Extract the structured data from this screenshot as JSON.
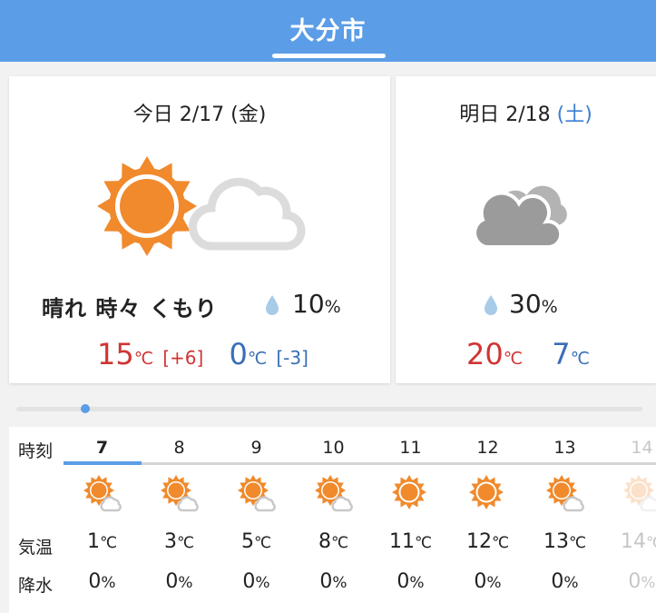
{
  "header": {
    "city": "大分市"
  },
  "today": {
    "date_label": "今日 2/17 (金)",
    "weather": "晴れ 時々 くもり",
    "precip": "10",
    "precip_unit": "%",
    "high": "15",
    "high_diff": "[+6]",
    "low": "0",
    "low_diff": "[-3]",
    "temp_unit": "℃",
    "icon": "sun-with-cloud-icon"
  },
  "tomorrow": {
    "date_prefix": "明日 2/18",
    "weekday": "(土)",
    "precip": "30",
    "precip_unit": "%",
    "high": "20",
    "low": "7",
    "temp_unit": "℃",
    "icon": "cloudy-icon"
  },
  "hourly": {
    "labels": {
      "time": "時刻",
      "temp": "気温",
      "precip": "降水"
    },
    "temp_unit": "℃",
    "precip_unit": "%",
    "hours": [
      {
        "hour": "7",
        "icon": "sun-cloud-icon",
        "temp": "1",
        "precip": "0"
      },
      {
        "hour": "8",
        "icon": "sun-cloud-icon",
        "temp": "3",
        "precip": "0"
      },
      {
        "hour": "9",
        "icon": "sun-cloud-icon",
        "temp": "5",
        "precip": "0"
      },
      {
        "hour": "10",
        "icon": "sun-cloud-icon",
        "temp": "8",
        "precip": "0"
      },
      {
        "hour": "11",
        "icon": "sun-icon",
        "temp": "11",
        "precip": "0"
      },
      {
        "hour": "12",
        "icon": "sun-icon",
        "temp": "12",
        "precip": "0"
      },
      {
        "hour": "13",
        "icon": "sun-cloud-icon",
        "temp": "13",
        "precip": "0"
      },
      {
        "hour": "14",
        "icon": "sun-cloud-icon",
        "temp": "14",
        "precip": "0"
      }
    ]
  },
  "colors": {
    "accent": "#5b9de6",
    "high": "#d03434",
    "low": "#3a6eb8",
    "sun": "#f08a2c"
  }
}
